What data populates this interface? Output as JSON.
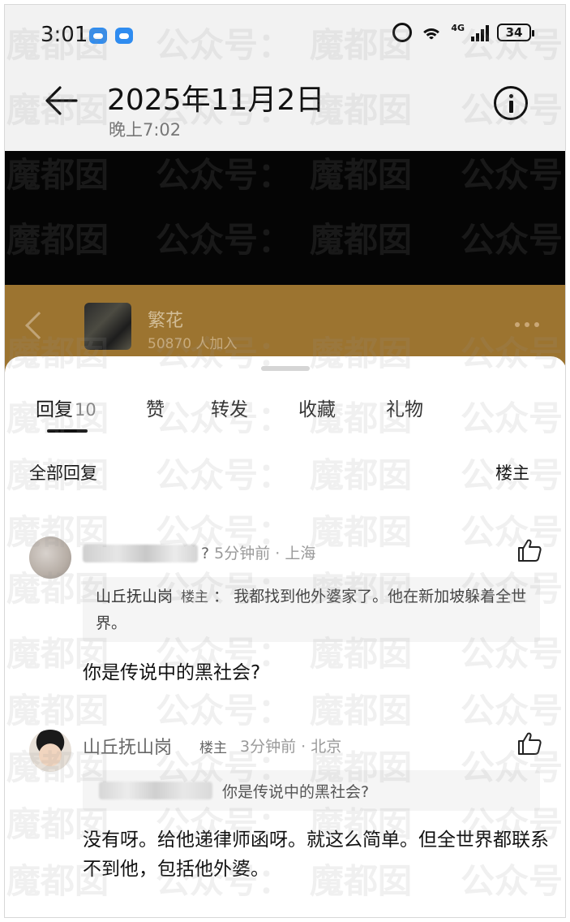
{
  "status_bar": {
    "time": "3:01",
    "battery": "34",
    "network": "4G"
  },
  "header": {
    "title": "2025年11月2日",
    "subtitle": "晚上7:02"
  },
  "group": {
    "name": "繁花",
    "members": "50870 人加入"
  },
  "tabs": [
    {
      "label": "回复",
      "count": "10"
    },
    {
      "label": "赞"
    },
    {
      "label": "转发"
    },
    {
      "label": "收藏"
    },
    {
      "label": "礼物"
    }
  ],
  "filter": {
    "all_replies": "全部回复",
    "owner_only": "楼主"
  },
  "comments": [
    {
      "name_visible_suffix": "?",
      "time": "5分钟前",
      "location": "上海",
      "quote": {
        "author": "山丘抚山岗",
        "tag": "楼主",
        "sep": "：",
        "text": "我都找到他外婆家了。他在新加坡躲着全世界。"
      },
      "text": "你是传说中的黑社会?"
    },
    {
      "name": "山丘抚山岗",
      "tag": "楼主",
      "time": "3分钟前",
      "location": "北京",
      "quote": {
        "text": "你是传说中的黑社会?"
      },
      "text": "没有呀。给他递律师函呀。就这么简单。但全世界都联系不到他，包括他外婆。"
    }
  ],
  "watermark": {
    "a": "魔都囡",
    "b": "公众号：",
    "c": "魔都囡",
    "d": "公众号"
  },
  "colors": {
    "group_bar": "#9c7430",
    "header_bg": "#f2f2f2",
    "cloud_icon": "#2f8cf0"
  }
}
